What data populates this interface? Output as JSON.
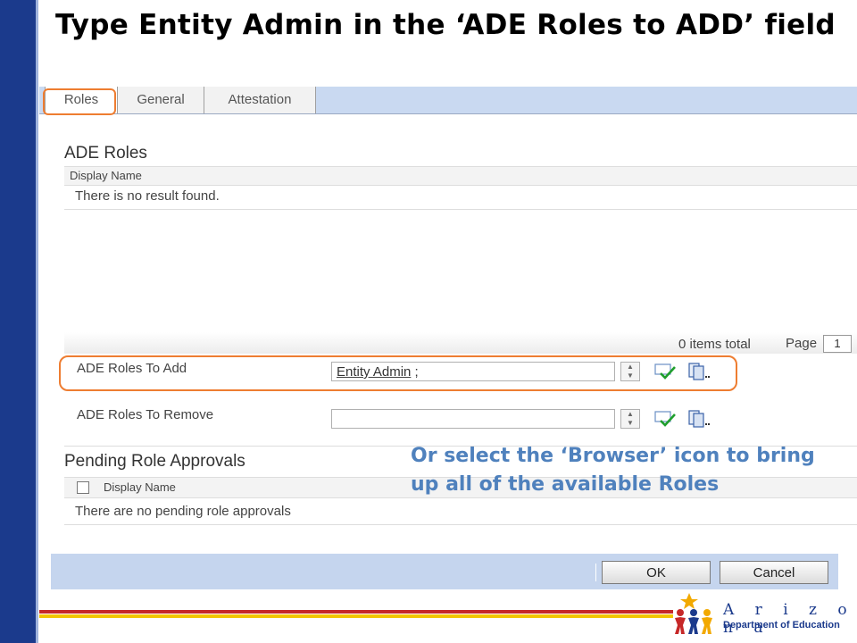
{
  "title": "Type Entity Admin in the ‘ADE Roles to ADD’ field",
  "tabs": [
    {
      "label": "Roles"
    },
    {
      "label": "General"
    },
    {
      "label": "Attestation"
    }
  ],
  "ade_roles": {
    "heading": "ADE Roles",
    "column_header": "Display Name",
    "empty_text": "There is no result found.",
    "items_total": "0 items total",
    "page_label": "Page",
    "page_number": "1"
  },
  "roles_to_add": {
    "label": "ADE Roles To Add",
    "value": "Entity Admin",
    "separator": ";"
  },
  "roles_to_remove": {
    "label": "ADE Roles To Remove",
    "value": ""
  },
  "pending": {
    "heading": "Pending Role Approvals",
    "column_header": "Display Name",
    "empty_text": "There are no pending role approvals"
  },
  "buttons": {
    "ok": "OK",
    "cancel": "Cancel"
  },
  "annotation": "Or select the ‘Browser’ icon to bring up all of the available Roles",
  "logo": {
    "state": "A r i z o n a",
    "department": "Department of Education"
  },
  "colors": {
    "accent_orange": "#ee7d31",
    "annotation_blue": "#4f81bd",
    "brand_navy": "#1b3a8c"
  },
  "icons": {
    "check": "check-names-icon",
    "browse": "browse-icon"
  }
}
